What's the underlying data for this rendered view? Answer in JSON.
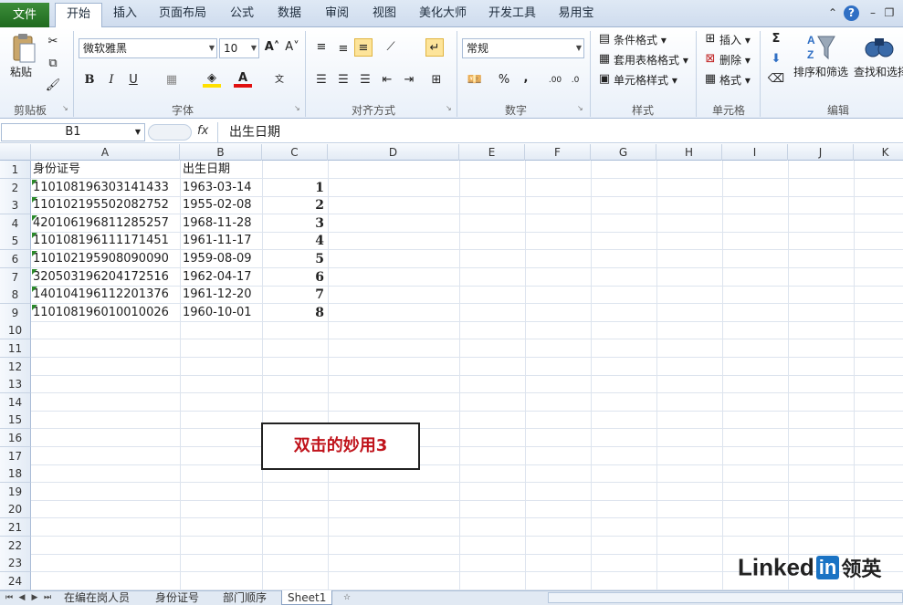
{
  "tabs": {
    "file": "文件",
    "items": [
      "开始",
      "插入",
      "页面布局",
      "公式",
      "数据",
      "审阅",
      "视图",
      "美化大师",
      "开发工具",
      "易用宝"
    ]
  },
  "ribbon": {
    "clipboard": {
      "paste": "粘贴",
      "label": "剪贴板"
    },
    "font": {
      "name": "微软雅黑",
      "size": "10",
      "label": "字体",
      "bold": "B",
      "italic": "I",
      "underline": "U"
    },
    "alignment": {
      "label": "对齐方式"
    },
    "number": {
      "format": "常规",
      "percent": "%",
      "comma": ",",
      "label": "数字"
    },
    "styles": {
      "conditional": "条件格式",
      "table": "套用表格格式",
      "cell": "单元格样式",
      "label": "样式"
    },
    "cells": {
      "insert": "插入",
      "delete": "删除",
      "format": "格式",
      "label": "单元格"
    },
    "editing": {
      "sort": "排序和筛选",
      "find": "查找和选择",
      "label": "编辑"
    }
  },
  "formula_bar": {
    "name_box": "B1",
    "fx": "fx",
    "content": "出生日期"
  },
  "columns": [
    "A",
    "B",
    "C",
    "D",
    "E",
    "F",
    "G",
    "H",
    "I",
    "J",
    "K"
  ],
  "rows": [
    "1",
    "2",
    "3",
    "4",
    "5",
    "6",
    "7",
    "8",
    "9",
    "10",
    "11",
    "12",
    "13",
    "14",
    "15",
    "16",
    "17",
    "18",
    "19",
    "20",
    "21",
    "22",
    "23",
    "24"
  ],
  "cells": [
    {
      "a": "身份证号",
      "b": "出生日期",
      "c": ""
    },
    {
      "a": "110108196303141433",
      "b": "1963-03-14",
      "c": "1"
    },
    {
      "a": "110102195502082752",
      "b": "1955-02-08",
      "c": "2"
    },
    {
      "a": "420106196811285257",
      "b": "1968-11-28",
      "c": "3"
    },
    {
      "a": "110108196111171451",
      "b": "1961-11-17",
      "c": "4"
    },
    {
      "a": "110102195908090090",
      "b": "1959-08-09",
      "c": "5"
    },
    {
      "a": "320503196204172516",
      "b": "1962-04-17",
      "c": "6"
    },
    {
      "a": "140104196112201376",
      "b": "1961-12-20",
      "c": "7"
    },
    {
      "a": "110108196010010026",
      "b": "1960-10-01",
      "c": "8"
    }
  ],
  "callout": "双击的妙用3",
  "sheets": [
    "在编在岗人员",
    "身份证号",
    "部门顺序",
    "Sheet1"
  ],
  "watermark": {
    "text": "Linked",
    "badge": "in",
    "suffix": "领英"
  },
  "colors": {
    "accent": "#2f6fc4",
    "file_tab": "#2a7a2a",
    "callout_text": "#c0141c"
  }
}
